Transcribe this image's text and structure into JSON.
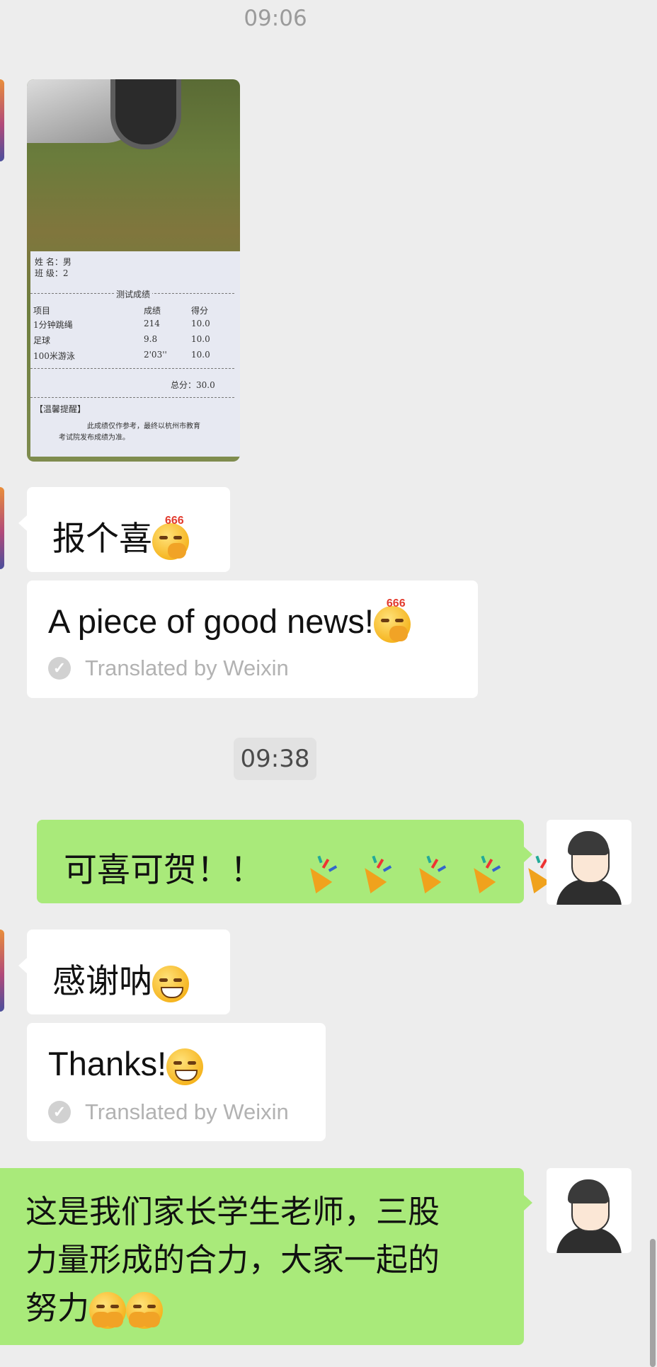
{
  "chat": {
    "time_top": "09:06",
    "time_mid": "09:38",
    "receipt": {
      "name_line": "姓  名：男",
      "class_line": "班  级：2",
      "section_title": "测试成绩",
      "col_item": "项目",
      "col_result": "成绩",
      "col_score": "得分",
      "rows": [
        {
          "item": "1分钟跳绳",
          "result": "214",
          "score": "10.0"
        },
        {
          "item": "足球",
          "result": "9.8",
          "score": "10.0"
        },
        {
          "item": "100米游泳",
          "result": "2'03''",
          "score": "10.0"
        }
      ],
      "total": "总分：30.0",
      "notice_title": "【温馨提醒】",
      "notice_line1": "此成绩仅作参考，最终以杭州市教育",
      "notice_line2": "考试院发布成绩为准。"
    },
    "messages": [
      {
        "text": "报个喜",
        "emoji": "666-face"
      },
      {
        "translation": "A piece of good news!",
        "label": "Translated by Weixin",
        "emoji": "666-face"
      },
      {
        "text": "可喜可贺！！",
        "emoji": "party-popper x5"
      },
      {
        "text": "感谢呐",
        "emoji": "grin-face"
      },
      {
        "translation": "Thanks!",
        "label": "Translated by Weixin",
        "emoji": "grin-face"
      },
      {
        "line1": "这是我们家长学生老师，三股",
        "line2": "力量形成的合力，大家一起的",
        "line3": "努力",
        "emoji": "hug-face x2"
      }
    ]
  },
  "colors": {
    "background": "#ededed",
    "incoming_bubble": "#ffffff",
    "outgoing_bubble": "#a9ea7a",
    "timestamp_pill": "#e2e2e2"
  }
}
